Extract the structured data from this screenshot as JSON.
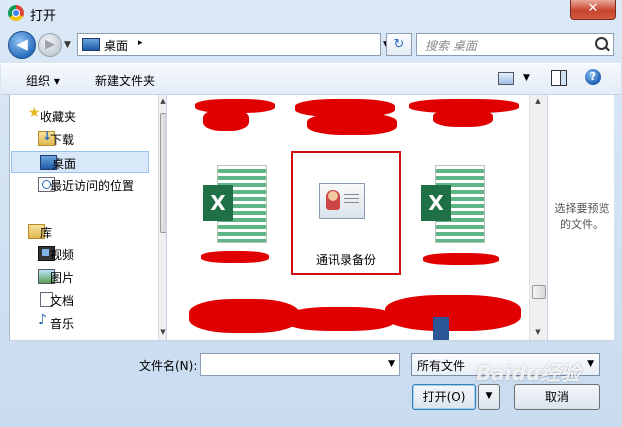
{
  "window": {
    "title": "打开",
    "close_glyph": "✕"
  },
  "nav": {
    "back_glyph": "◀",
    "forward_glyph": "▶",
    "address": {
      "location": "桌面",
      "separator": "▸"
    },
    "refresh_glyph": "↻",
    "search_placeholder": "搜索 桌面"
  },
  "toolbar": {
    "organize": "组织 ▾",
    "new_folder": "新建文件夹",
    "help": "?"
  },
  "sidebar": {
    "favorites": "收藏夹",
    "items": [
      {
        "label": "下载",
        "icon": "download-folder-icon"
      },
      {
        "label": "桌面",
        "icon": "desktop-icon",
        "selected": true
      },
      {
        "label": "最近访问的位置",
        "icon": "recent-places-icon"
      }
    ],
    "libraries": "库",
    "library_items": [
      {
        "label": "视频",
        "icon": "video-icon"
      },
      {
        "label": "图片",
        "icon": "pictures-icon"
      },
      {
        "label": "文档",
        "icon": "documents-icon"
      },
      {
        "label": "音乐",
        "icon": "music-icon"
      }
    ]
  },
  "files": {
    "items": [
      {
        "type": "excel",
        "label_redacted": true,
        "badge": "X"
      },
      {
        "type": "contacts",
        "label": "通讯录备份",
        "selected": true
      },
      {
        "type": "excel",
        "label_redacted": true,
        "badge": "X"
      }
    ]
  },
  "preview": {
    "message": "选择要预览的文件。"
  },
  "footer": {
    "filename_label": "文件名(N):",
    "filename_value": "",
    "filetype": "所有文件",
    "open_button": "打开(O)",
    "cancel_button": "取消",
    "watermark": "Baidu经验"
  },
  "colors": {
    "selection_border": "#d01010",
    "redaction": "#e00000",
    "accent": "#3c7fb1"
  }
}
